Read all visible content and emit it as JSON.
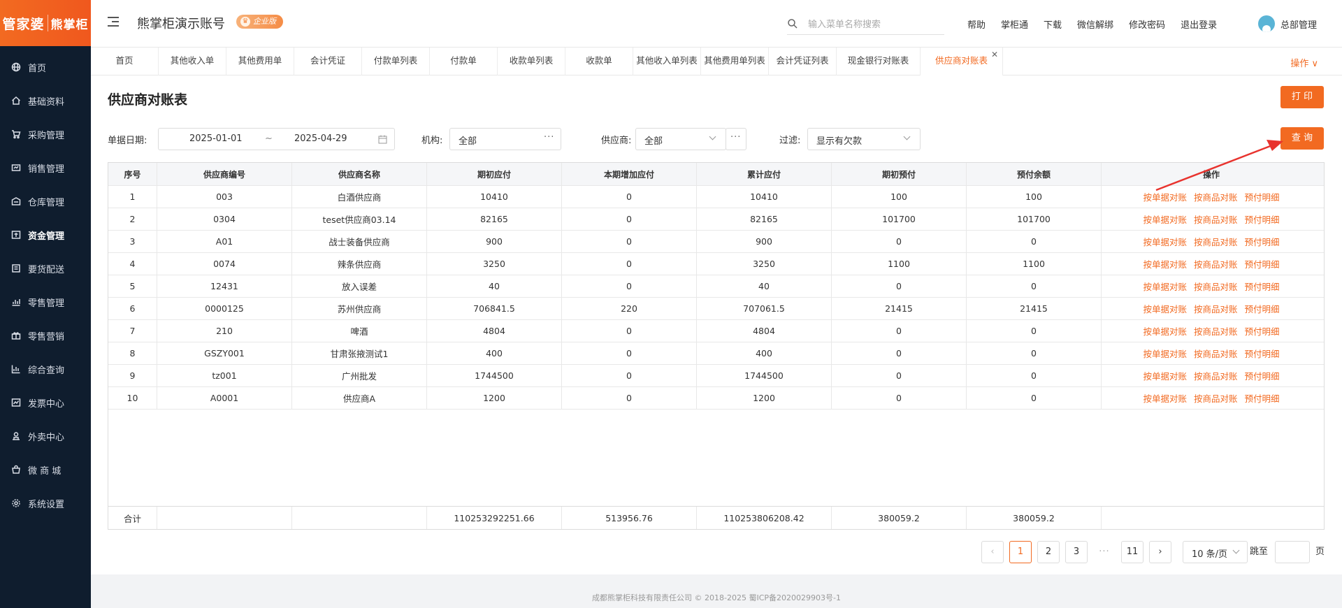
{
  "brand": {
    "left": "管家婆",
    "right": "熊掌柜"
  },
  "sidebar": {
    "items": [
      {
        "label": "首页",
        "icon": "globe-icon"
      },
      {
        "label": "基础资料",
        "icon": "home-icon"
      },
      {
        "label": "采购管理",
        "icon": "cart-icon"
      },
      {
        "label": "销售管理",
        "icon": "sales-icon"
      },
      {
        "label": "仓库管理",
        "icon": "warehouse-icon"
      },
      {
        "label": "资金管理",
        "icon": "fund-icon"
      },
      {
        "label": "要货配送",
        "icon": "delivery-icon"
      },
      {
        "label": "零售管理",
        "icon": "retail-icon"
      },
      {
        "label": "零售营销",
        "icon": "gift-icon"
      },
      {
        "label": "综合查询",
        "icon": "chart-icon"
      },
      {
        "label": "发票中心",
        "icon": "invoice-icon"
      },
      {
        "label": "外卖中心",
        "icon": "takeout-icon"
      },
      {
        "label": "微 商 城",
        "icon": "shop-icon"
      },
      {
        "label": "系统设置",
        "icon": "gear-icon"
      }
    ]
  },
  "header": {
    "account": "熊掌柜演示账号",
    "edition": "企业版",
    "search_placeholder": "输入菜单名称搜索",
    "links": [
      "帮助",
      "掌柜通",
      "下载",
      "微信解绑",
      "修改密码",
      "退出登录"
    ],
    "user": "总部管理"
  },
  "tabs": {
    "items": [
      "首页",
      "其他收入单",
      "其他费用单",
      "会计凭证",
      "付款单列表",
      "付款单",
      "收款单列表",
      "收款单",
      "其他收入单列表",
      "其他费用单列表",
      "会计凭证列表",
      "现金银行对账表",
      "供应商对账表"
    ],
    "active": "供应商对账表",
    "ops": "操作 ∨"
  },
  "page": {
    "title": "供应商对账表",
    "print": "打 印",
    "query": "查 询"
  },
  "filters": {
    "date_label": "单据日期:",
    "date_start": "2025-01-01",
    "date_sep": "~",
    "date_end": "2025-04-29",
    "org_label": "机构:",
    "org_value": "全部",
    "supplier_label": "供应商:",
    "supplier_value": "全部",
    "filter_label": "过滤:",
    "filter_value": "显示有欠款"
  },
  "table": {
    "columns": [
      "序号",
      "供应商编号",
      "供应商名称",
      "期初应付",
      "本期增加应付",
      "累计应付",
      "期初预付",
      "预付余额",
      "操作"
    ],
    "rows": [
      [
        "1",
        "003",
        "白酒供应商",
        "10410",
        "0",
        "10410",
        "100",
        "100"
      ],
      [
        "2",
        "0304",
        "teset供应商03.14",
        "82165",
        "0",
        "82165",
        "101700",
        "101700"
      ],
      [
        "3",
        "A01",
        "战士装备供应商",
        "900",
        "0",
        "900",
        "0",
        "0"
      ],
      [
        "4",
        "0074",
        "辣条供应商",
        "3250",
        "0",
        "3250",
        "1100",
        "1100"
      ],
      [
        "5",
        "12431",
        "放入误差",
        "40",
        "0",
        "40",
        "0",
        "0"
      ],
      [
        "6",
        "0000125",
        "苏州供应商",
        "706841.5",
        "220",
        "707061.5",
        "21415",
        "21415"
      ],
      [
        "7",
        "210",
        "啤酒",
        "4804",
        "0",
        "4804",
        "0",
        "0"
      ],
      [
        "8",
        "GSZY001",
        "甘肃张掖测试1",
        "400",
        "0",
        "400",
        "0",
        "0"
      ],
      [
        "9",
        "tz001",
        "广州批发",
        "1744500",
        "0",
        "1744500",
        "0",
        "0"
      ],
      [
        "10",
        "A0001",
        "供应商A",
        "1200",
        "0",
        "1200",
        "0",
        "0"
      ]
    ],
    "ops": [
      "按单据对账",
      "按商品对账",
      "预付明细"
    ],
    "total": [
      "合计",
      "",
      "",
      "110253292251.66",
      "513956.76",
      "110253806208.42",
      "380059.2",
      "380059.2",
      ""
    ]
  },
  "pagination": {
    "pages": [
      "1",
      "2",
      "3",
      "11"
    ],
    "ellipsis": "···",
    "current": "1",
    "size": "10 条/页",
    "jump_label": "跳至",
    "page_unit": "页"
  },
  "footer": "成都熊掌柜科技有限责任公司 © 2018-2025 蜀ICP备2020029903号-1",
  "colors": {
    "accent": "#f26a21",
    "sidebar": "#0f1d2e"
  }
}
